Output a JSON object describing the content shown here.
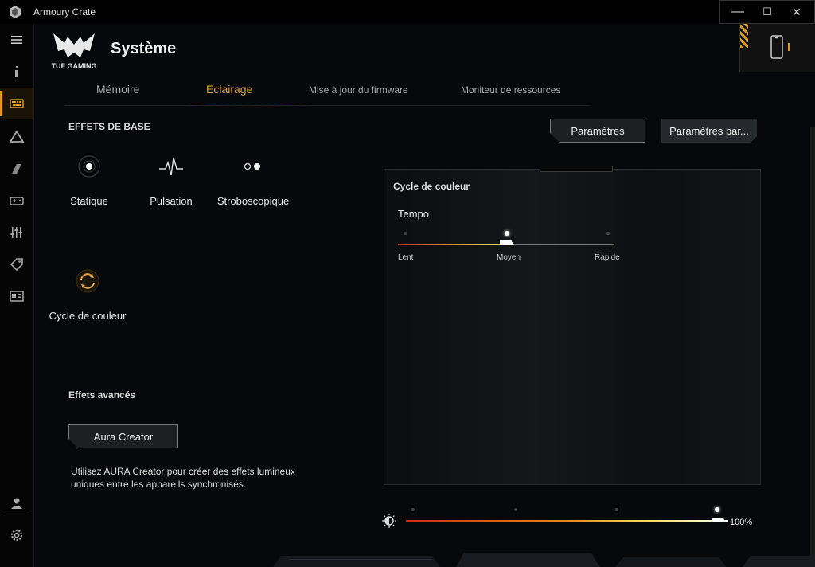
{
  "window": {
    "title": "Armoury Crate",
    "minimize_glyph": "—",
    "maximize_glyph": "☐",
    "close_glyph": "✕"
  },
  "header": {
    "logo_text": "TUF GAMING",
    "title": "Système"
  },
  "tabs": [
    {
      "label": "Mémoire"
    },
    {
      "label": "Éclairage"
    },
    {
      "label": "Mise à jour du firmware"
    },
    {
      "label": "Moniteur de ressources"
    }
  ],
  "active_tab": "Éclairage",
  "basic_effects": {
    "title": "EFFETS DE BASE",
    "items": [
      {
        "label": "Statique",
        "icon": "static-icon"
      },
      {
        "label": "Pulsation",
        "icon": "pulse-icon"
      },
      {
        "label": "Stroboscopique",
        "icon": "strobe-icon"
      },
      {
        "label": "Cycle de couleur",
        "icon": "color-cycle-icon"
      }
    ]
  },
  "buttons": {
    "settings": "Paramètres",
    "settings_more": "Paramètres par..."
  },
  "advanced_effects": {
    "title": "Effets avancés",
    "aura_button": "Aura Creator",
    "description": "Utilisez AURA Creator pour créer des effets lumineux uniques entre les appareils synchronisés."
  },
  "panel": {
    "title": "Cycle de couleur",
    "tempo_label": "Tempo",
    "tempo_levels": [
      "Lent",
      "Moyen",
      "Rapide"
    ],
    "tempo_selected": "Moyen",
    "tempo_fraction": 0.5
  },
  "brightness": {
    "value": "100%",
    "fraction": 1.0
  },
  "colors": {
    "accent": "#e3a33a",
    "gradient_start": "#d02a1a",
    "gradient_mid": "#e08c1a",
    "gradient_end": "#f0e060"
  }
}
